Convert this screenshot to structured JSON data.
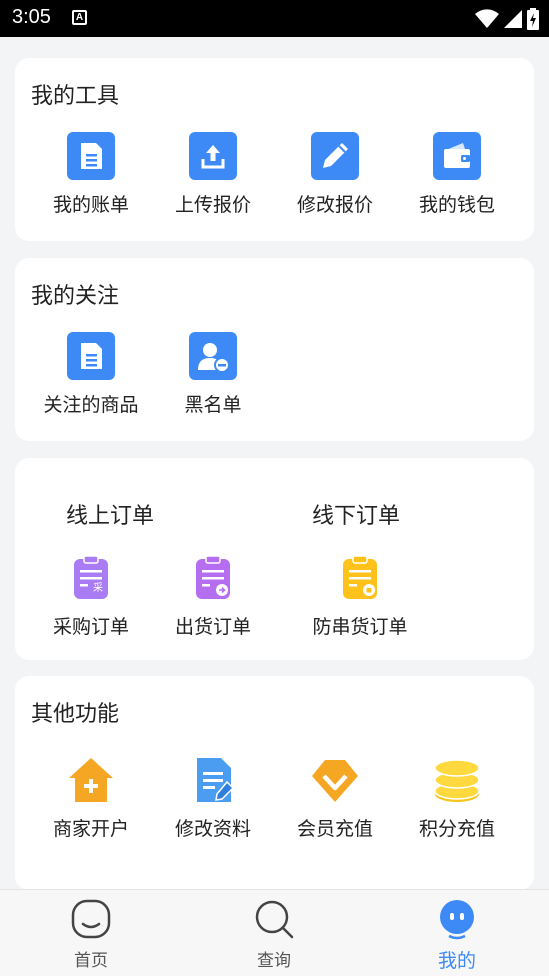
{
  "status": {
    "time": "3:05",
    "notif_glyph": "A"
  },
  "tools": {
    "title": "我的工具",
    "items": [
      {
        "label": "我的账单",
        "icon": "bill-icon"
      },
      {
        "label": "上传报价",
        "icon": "upload-icon"
      },
      {
        "label": "修改报价",
        "icon": "edit-icon"
      },
      {
        "label": "我的钱包",
        "icon": "wallet-icon"
      }
    ]
  },
  "follow": {
    "title": "我的关注",
    "items": [
      {
        "label": "关注的商品",
        "icon": "doc-icon"
      },
      {
        "label": "黑名单",
        "icon": "blacklist-user-icon"
      }
    ]
  },
  "orders": {
    "online_title": "线上订单",
    "offline_title": "线下订单",
    "items": [
      {
        "label": "采购订单",
        "icon": "purchase-order-icon",
        "badge": "采"
      },
      {
        "label": "出货订单",
        "icon": "shipping-order-icon"
      },
      {
        "label": "防串货订单",
        "icon": "anti-diversion-order-icon"
      }
    ]
  },
  "other": {
    "title": "其他功能",
    "items": [
      {
        "label": "商家开户",
        "icon": "merchant-house-icon"
      },
      {
        "label": "修改资料",
        "icon": "edit-profile-icon"
      },
      {
        "label": "会员充值",
        "icon": "vip-diamond-icon"
      },
      {
        "label": "积分充值",
        "icon": "coins-icon"
      }
    ]
  },
  "tabbar": {
    "items": [
      {
        "label": "首页",
        "icon": "home-face-icon"
      },
      {
        "label": "查询",
        "icon": "search-icon"
      },
      {
        "label": "我的",
        "icon": "profile-face-icon"
      }
    ],
    "active_index": 2
  },
  "colors": {
    "accent": "#3d8af7",
    "purple": "#a97bf5",
    "yellow": "#ffc21a",
    "orange": "#f5a623"
  }
}
